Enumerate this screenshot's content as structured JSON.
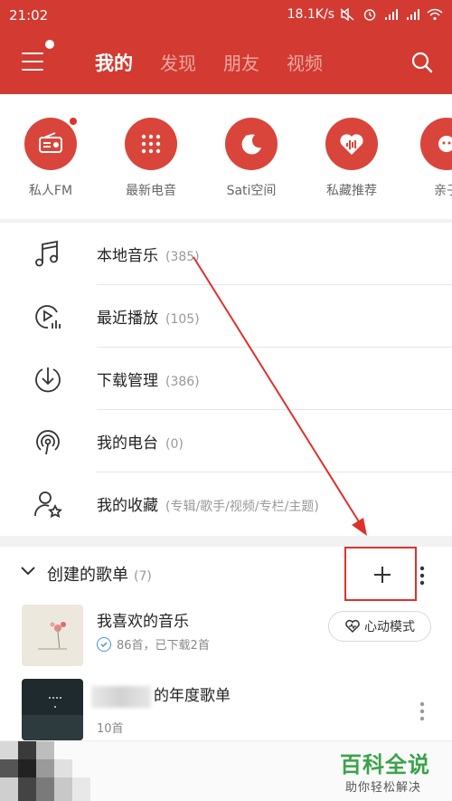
{
  "status_bar": {
    "time": "21:02",
    "network_speed": "18.1K/s",
    "icons": [
      "mute-icon",
      "alarm-icon",
      "signal-icon",
      "signal-icon",
      "wifi-icon"
    ]
  },
  "app_bar": {
    "tabs": [
      {
        "label": "我的",
        "active": true
      },
      {
        "label": "发现",
        "active": false
      },
      {
        "label": "朋友",
        "active": false
      },
      {
        "label": "视频",
        "active": false
      }
    ]
  },
  "shortcuts": [
    {
      "label": "私人FM",
      "icon": "radio-icon",
      "badge": true
    },
    {
      "label": "最新电音",
      "icon": "keypad-icon",
      "badge": false
    },
    {
      "label": "Sati空间",
      "icon": "moon-icon",
      "badge": false
    },
    {
      "label": "私藏推荐",
      "icon": "heart-wave-icon",
      "badge": false
    },
    {
      "label": "亲子",
      "icon": "kids-icon",
      "badge": false
    }
  ],
  "menu": [
    {
      "label": "本地音乐",
      "count": "(385)",
      "icon": "music-note-icon"
    },
    {
      "label": "最近播放",
      "count": "(105)",
      "icon": "recent-play-icon"
    },
    {
      "label": "下载管理",
      "count": "(386)",
      "icon": "download-icon"
    },
    {
      "label": "我的电台",
      "count": "(0)",
      "icon": "podcast-icon"
    },
    {
      "label": "我的收藏",
      "count": "(专辑/歌手/视频/专栏/主题)",
      "icon": "collection-icon"
    }
  ],
  "created_playlists": {
    "title": "创建的歌单",
    "count": "(7)",
    "items": [
      {
        "name": "我喜欢的音乐",
        "subtitle": "86首，已下载2首",
        "action_label": "心动模式"
      },
      {
        "name": "的年度歌单",
        "subtitle": "10首"
      }
    ]
  },
  "watermark": {
    "title": "百科全说",
    "subtitle": "助你轻松解决"
  },
  "colors": {
    "brand_red": "#d33a31",
    "annotation_red": "#e0302a",
    "watermark_green": "#3aa34a"
  }
}
